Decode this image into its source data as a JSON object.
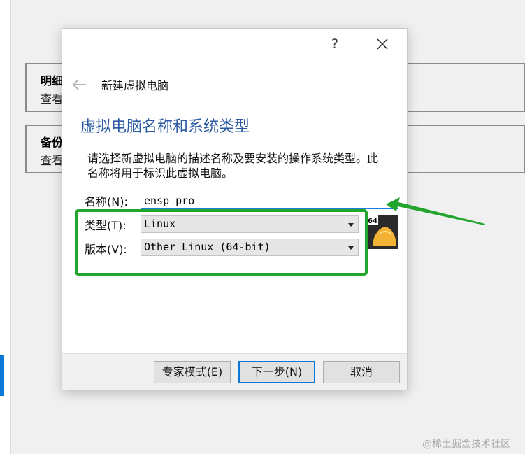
{
  "background": {
    "cards": [
      {
        "title": "明细",
        "subtitle": "查看"
      },
      {
        "title": "备份",
        "subtitle": "查看"
      }
    ]
  },
  "dialog": {
    "help_label": "?",
    "heading": "新建虚拟电脑",
    "page_title": "虚拟电脑名称和系统类型",
    "description": "请选择新虚拟电脑的描述名称及要安装的操作系统类型。此名称将用于标识此虚拟电脑。",
    "name_label": "名称(N):",
    "name_value": "ensp pro",
    "type_label": "类型(T):",
    "type_value": "Linux",
    "version_label": "版本(V):",
    "version_value": "Other Linux (64-bit)",
    "os_badge": "64",
    "buttons": {
      "expert": "专家模式(E)",
      "next": "下一步(N)",
      "cancel": "取消"
    }
  },
  "colors": {
    "title_blue": "#2b5aa3",
    "annotation_green": "#22a52c",
    "focus_blue": "#0a78d7"
  },
  "watermark": "@稀土掘金技术社区"
}
